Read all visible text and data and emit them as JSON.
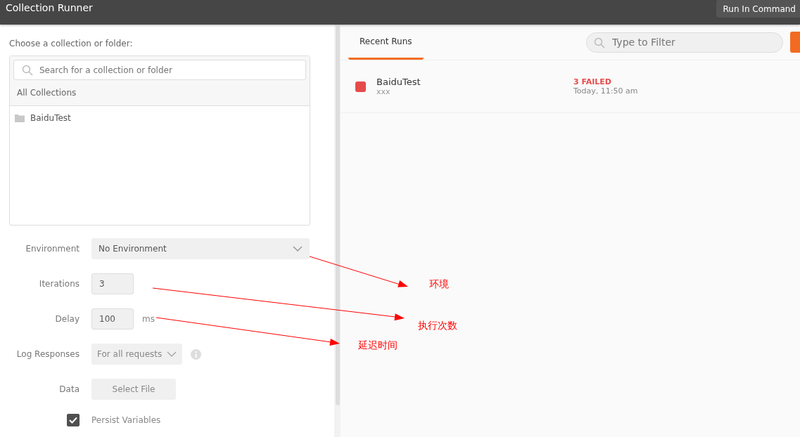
{
  "window": {
    "title": "Collection Runner",
    "action": "Run In Command"
  },
  "chooser": {
    "label": "Choose a collection or folder:",
    "search": {
      "placeholder": "Search for a collection or folder"
    },
    "header": "All Collections",
    "items": [
      {
        "name": "BaiduTest"
      }
    ]
  },
  "settings": {
    "environment": {
      "label": "Environment",
      "value": "No Environment"
    },
    "iterations": {
      "label": "Iterations",
      "value": "3"
    },
    "delay": {
      "label": "Delay",
      "value": "100",
      "unit": "ms"
    },
    "log_responses": {
      "label": "Log Responses",
      "value": "For all requests"
    },
    "data": {
      "label": "Data",
      "button": "Select File"
    },
    "persist_variables": {
      "label": "Persist Variables",
      "checked": true
    }
  },
  "tabs": [
    {
      "label": "Recent Runs",
      "selected": true
    }
  ],
  "filter": {
    "placeholder": "Type to Filter"
  },
  "runs": [
    {
      "name": "BaiduTest",
      "environment": "xxx",
      "result": "3 FAILED",
      "time": "Today, 11:50 am",
      "color": "#e64b4b"
    }
  ],
  "annotations": [
    {
      "text": "环境"
    },
    {
      "text": "执行次数"
    },
    {
      "text": "延迟时间"
    }
  ]
}
